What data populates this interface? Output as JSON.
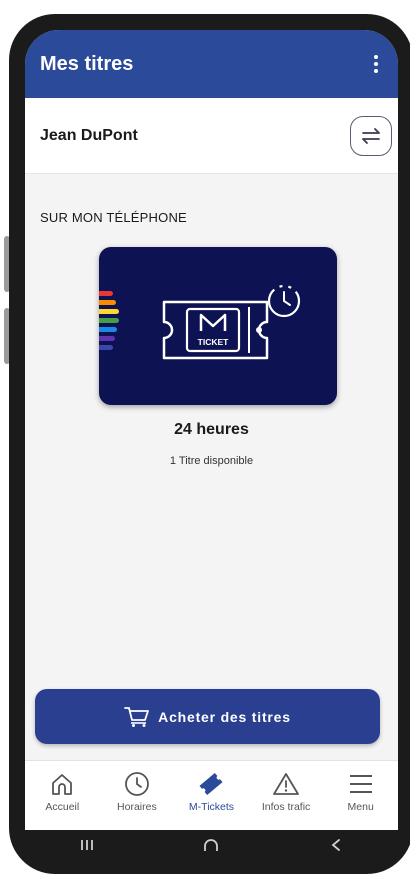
{
  "header": {
    "title": "Mes titres"
  },
  "user": {
    "name": "Jean DuPont"
  },
  "section": {
    "label": "SUR MON TÉLÉPHONE"
  },
  "ticket": {
    "card_text": "TICKET",
    "card_letter": "M",
    "name": "24 heures",
    "availability": "1 Titre disponible",
    "stripe_colors": [
      "#e53935",
      "#fb8c00",
      "#fdd835",
      "#43a047",
      "#1e88e5",
      "#5e35b1",
      "#3949ab"
    ]
  },
  "actions": {
    "buy_label": "Acheter des titres"
  },
  "nav": {
    "items": [
      {
        "label": "Accueil",
        "icon": "home-icon"
      },
      {
        "label": "Horaires",
        "icon": "clock-icon"
      },
      {
        "label": "M-Tickets",
        "icon": "ticket-icon",
        "active": true
      },
      {
        "label": "Infos trafic",
        "icon": "warning-icon"
      },
      {
        "label": "Menu",
        "icon": "menu-icon"
      }
    ]
  },
  "colors": {
    "primary": "#2b4a99",
    "card_bg": "#0d1252",
    "button_bg": "#2a3f8f"
  }
}
